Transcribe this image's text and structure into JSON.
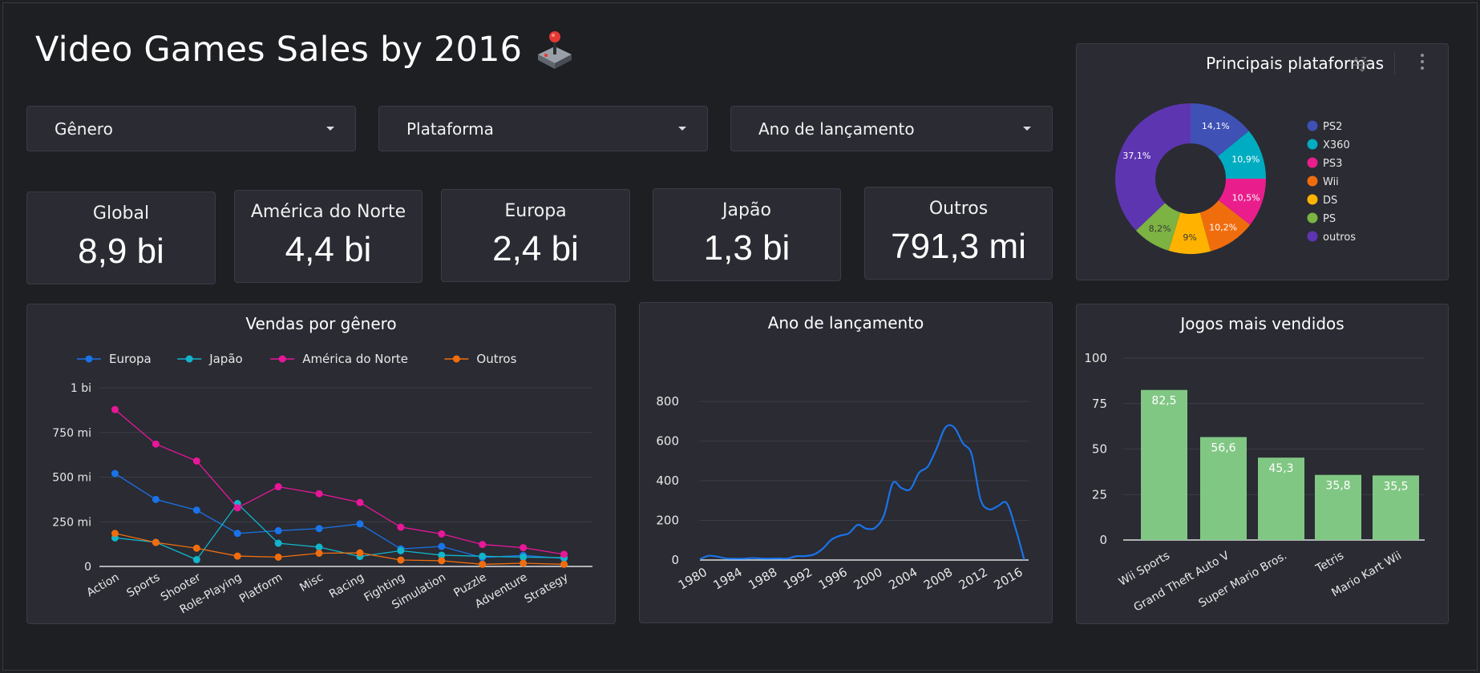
{
  "header": {
    "title": "Video Games Sales by 2016",
    "icon": "joystick-icon"
  },
  "filters": [
    {
      "label": "Gênero"
    },
    {
      "label": "Plataforma"
    },
    {
      "label": "Ano de lançamento"
    }
  ],
  "kpis": [
    {
      "label": "Global",
      "value": "8,9 bi"
    },
    {
      "label": "América do Norte",
      "value": "4,4 bi"
    },
    {
      "label": "Europa",
      "value": "2,4 bi"
    },
    {
      "label": "Japão",
      "value": "1,3 bi"
    },
    {
      "label": "Outros",
      "value": "791,3 mi"
    }
  ],
  "pie_panel": {
    "title": "Principais plataformas",
    "sort_icon": "sort-az-icon",
    "menu_icon": "more-vert-icon"
  },
  "genre_panel": {
    "title": "Vendas por gênero"
  },
  "year_panel": {
    "title": "Ano de lançamento"
  },
  "top_panel": {
    "title": "Jogos mais vendidos"
  },
  "chart_data": [
    {
      "type": "pie",
      "title": "Principais plataformas",
      "donut": true,
      "legend_position": "right",
      "slices": [
        {
          "label": "PS2",
          "value": 14.1,
          "text": "14,1%",
          "color": "#3f51b5"
        },
        {
          "label": "X360",
          "value": 10.9,
          "text": "10,9%",
          "color": "#00acc1"
        },
        {
          "label": "PS3",
          "value": 10.5,
          "text": "10,5%",
          "color": "#e91e8c"
        },
        {
          "label": "Wii",
          "value": 10.2,
          "text": "10,2%",
          "color": "#f06d0e"
        },
        {
          "label": "DS",
          "value": 9.0,
          "text": "9%",
          "color": "#ffb300"
        },
        {
          "label": "PS",
          "value": 8.2,
          "text": "8,2%",
          "color": "#7cb342"
        },
        {
          "label": "outros",
          "value": 37.1,
          "text": "37,1%",
          "color": "#5e35b1"
        }
      ]
    },
    {
      "type": "line",
      "title": "Vendas por gênero",
      "legend_position": "top",
      "categories": [
        "Action",
        "Sports",
        "Shooter",
        "Role-Playing",
        "Platform",
        "Misc",
        "Racing",
        "Fighting",
        "Simulation",
        "Puzzle",
        "Adventure",
        "Strategy"
      ],
      "y_ticks": [
        {
          "value": 0,
          "label": "0"
        },
        {
          "value": 250,
          "label": "250 mi"
        },
        {
          "value": 500,
          "label": "500 mi"
        },
        {
          "value": 750,
          "label": "750 mi"
        },
        {
          "value": 1000,
          "label": "1 bi"
        }
      ],
      "ylim": [
        0,
        1000
      ],
      "series": [
        {
          "name": "Europa",
          "color": "#1a73e8",
          "values": [
            520,
            375,
            315,
            185,
            200,
            212,
            238,
            98,
            112,
            50,
            62,
            45
          ]
        },
        {
          "name": "Japão",
          "color": "#12b5cb",
          "values": [
            160,
            135,
            38,
            352,
            130,
            108,
            56,
            88,
            63,
            57,
            52,
            49
          ]
        },
        {
          "name": "América do Norte",
          "color": "#e8179a",
          "values": [
            878,
            685,
            590,
            328,
            446,
            407,
            358,
            220,
            182,
            123,
            105,
            68
          ]
        },
        {
          "name": "Outros",
          "color": "#f06d0e",
          "values": [
            185,
            134,
            102,
            58,
            52,
            74,
            76,
            36,
            32,
            12,
            18,
            12
          ]
        }
      ]
    },
    {
      "type": "line",
      "title": "Ano de lançamento",
      "x_ticks": [
        "1980",
        "1984",
        "1988",
        "1992",
        "1996",
        "2000",
        "2004",
        "2008",
        "2012",
        "2016"
      ],
      "y_ticks": [
        "0",
        "200",
        "400",
        "600",
        "800"
      ],
      "ylim": [
        0,
        900
      ],
      "series": [
        {
          "color": "#1a73e8",
          "points": [
            [
              1980,
              9
            ],
            [
              1981,
              46
            ],
            [
              1982,
              36
            ],
            [
              1983,
              17
            ],
            [
              1984,
              14
            ],
            [
              1985,
              14
            ],
            [
              1986,
              21
            ],
            [
              1987,
              16
            ],
            [
              1988,
              15
            ],
            [
              1989,
              17
            ],
            [
              1990,
              16
            ],
            [
              1991,
              41
            ],
            [
              1992,
              43
            ],
            [
              1993,
              60
            ],
            [
              1994,
              121
            ],
            [
              1995,
              219
            ],
            [
              1996,
              263
            ],
            [
              1997,
              289
            ],
            [
              1998,
              379
            ],
            [
              1999,
              338
            ],
            [
              2000,
              349
            ],
            [
              2001,
              482
            ],
            [
              2002,
              829
            ],
            [
              2003,
              775
            ],
            [
              2004,
              763
            ],
            [
              2005,
              941
            ],
            [
              2006,
              1008
            ],
            [
              2007,
              1202
            ],
            [
              2008,
              1428
            ],
            [
              2009,
              1431
            ],
            [
              2010,
              1259
            ],
            [
              2011,
              1139
            ],
            [
              2012,
              657
            ],
            [
              2013,
              546
            ],
            [
              2014,
              582
            ],
            [
              2015,
              614
            ],
            [
              2016,
              344
            ],
            [
              2017,
              3
            ]
          ],
          "scale_note": "relative"
        }
      ]
    },
    {
      "type": "bar",
      "title": "Jogos mais vendidos",
      "categories": [
        "Wii Sports",
        "Grand Theft Auto V",
        "Super Mario Bros.",
        "Tetris",
        "Mario Kart Wii"
      ],
      "values": [
        82.5,
        56.6,
        45.3,
        35.8,
        35.5
      ],
      "labels": [
        "82,5",
        "56,6",
        "45,3",
        "35,8",
        "35,5"
      ],
      "y_ticks": [
        "0",
        "25",
        "50",
        "75",
        "100"
      ],
      "ylim": [
        0,
        100
      ],
      "color": "#81c784"
    }
  ]
}
